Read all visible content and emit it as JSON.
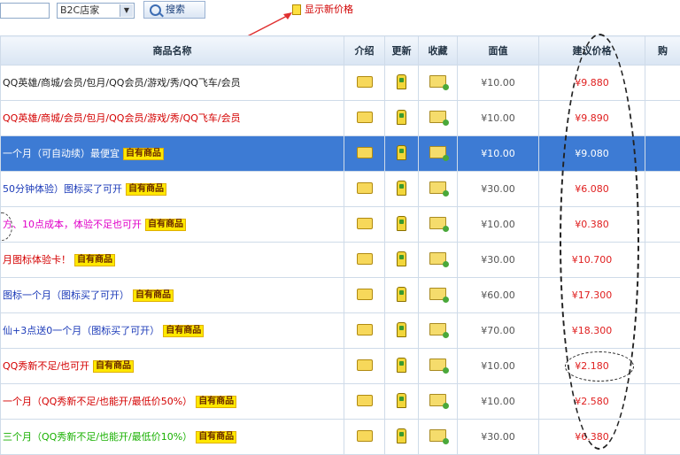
{
  "toolbar": {
    "search_value": "",
    "select_value": "B2C店家",
    "search_button": "搜索",
    "alert_link": "显示新价格"
  },
  "columns": [
    "商品名称",
    "介绍",
    "更新",
    "收藏",
    "面值",
    "建议价格",
    "购"
  ],
  "rows": [
    {
      "name": "QQ英雄/商城/会员/包月/QQ会员/游戏/秀/QQ飞车/会员",
      "tag": "",
      "price": "¥10.00",
      "settle": "¥9.880",
      "more": "",
      "style": "dark"
    },
    {
      "name": "QQ英雄/商城/会员/包月/QQ会员/游戏/秀/QQ飞车/会员",
      "tag": "",
      "price": "¥10.00",
      "settle": "¥9.890",
      "more": "",
      "style": "red"
    },
    {
      "name": "一个月（可自动续）最便宜",
      "tag": "自有商品",
      "price": "¥10.00",
      "settle": "¥9.080",
      "more": "",
      "style": "sel"
    },
    {
      "name": "50分钟体验）图标买了可开",
      "tag": "自有商品",
      "price": "¥30.00",
      "settle": "¥6.080",
      "more": "",
      "style": "blue"
    },
    {
      "name": "方、10点成本，体验不足也可开",
      "tag": "自有商品",
      "price": "¥10.00",
      "settle": "¥0.380",
      "more": "",
      "style": "pink"
    },
    {
      "name": "月图标体验卡！",
      "tag": "自有商品",
      "price": "¥30.00",
      "settle": "¥10.700",
      "more": "",
      "style": "red"
    },
    {
      "name": "图标一个月（图标买了可开）",
      "tag": "自有商品",
      "price": "¥60.00",
      "settle": "¥17.300",
      "more": "",
      "style": "blue"
    },
    {
      "name": "仙+3点送0一个月（图标买了可开）",
      "tag": "自有商品",
      "price": "¥70.00",
      "settle": "¥18.300",
      "more": "",
      "style": "blue"
    },
    {
      "name": "QQ秀新不足/也可开",
      "tag": "自有商品",
      "price": "¥10.00",
      "settle": "¥2.180",
      "more": "",
      "style": "red"
    },
    {
      "name": "一个月（QQ秀新不足/也能开/最低价50%）",
      "tag": "自有商品",
      "price": "¥10.00",
      "settle": "¥2.580",
      "more": "",
      "style": "red"
    },
    {
      "name": "三个月（QQ秀新不足/也能开/最低价10%）",
      "tag": "自有商品",
      "price": "¥30.00",
      "settle": "¥6.380",
      "more": "",
      "style": "green"
    }
  ],
  "colors": {
    "accent": "#3d7bd4",
    "price_red": "#e02020",
    "tag_yellow": "#ffe800"
  }
}
